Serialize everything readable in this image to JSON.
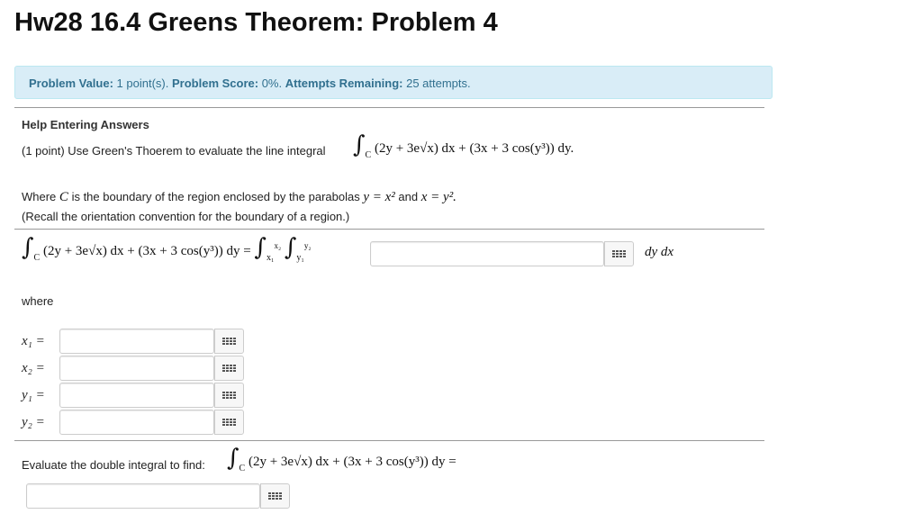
{
  "title": "Hw28 16.4 Greens Theorem: Problem 4",
  "info": {
    "value_label": "Problem Value:",
    "value": "1 point(s).",
    "score_label": "Problem Score:",
    "score": "0%.",
    "attempts_label": "Attempts Remaining:",
    "attempts": "25 attempts."
  },
  "help_link": "Help Entering Answers",
  "problem": {
    "intro": "(1 point) Use Green's Thoerem to evaluate the line integral",
    "where_c_pre": "Where",
    "where_c_var": "C",
    "where_c_post": "is the boundary of the region enclosed by the parabolas",
    "eq1": "y = x²",
    "and": "and",
    "eq2": "x = y².",
    "recall": "(Recall the orientation convention for the boundary of a region.)"
  },
  "integrand": "(2y + 3e√x) dx + (3x + 3 cos(y³)) dy",
  "double_integral_suffix": "dy dx",
  "where_label": "where",
  "variables": [
    {
      "label": "x₁ ="
    },
    {
      "label": "x₂ ="
    },
    {
      "label": "y₁ ="
    },
    {
      "label": "y₂ ="
    }
  ],
  "evaluate_label": "Evaluate the double integral to find:",
  "inputs": {
    "integrand_value": "",
    "x1": "",
    "x2": "",
    "y1": "",
    "y2": "",
    "final": ""
  }
}
